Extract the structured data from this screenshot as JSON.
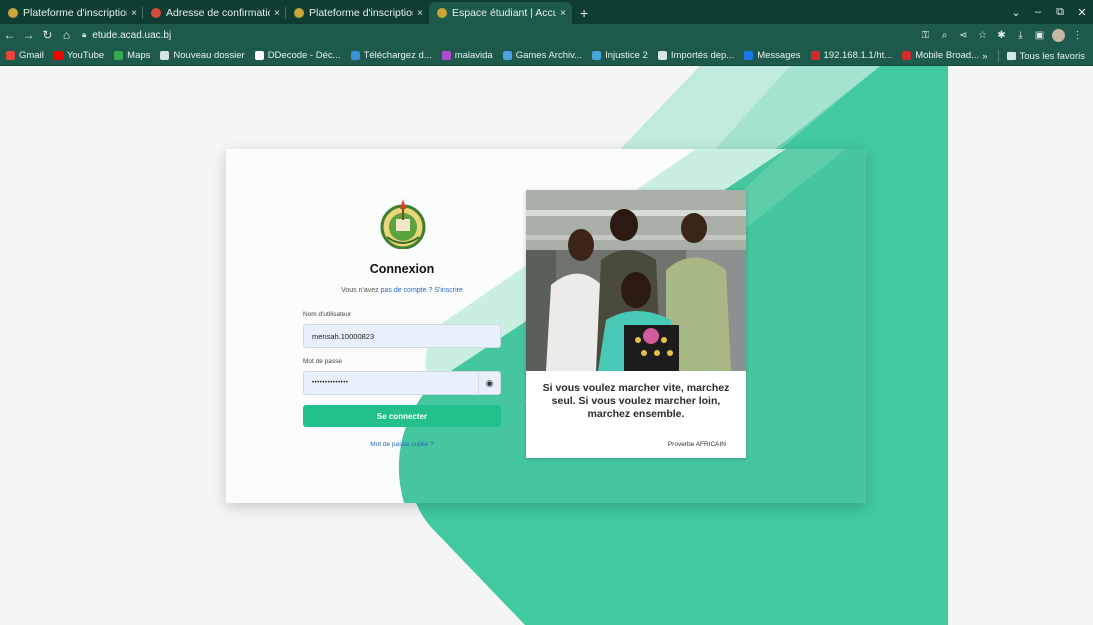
{
  "browser": {
    "tabs": [
      {
        "title": "Plateforme d'inscription",
        "favicon_color": "#c9a53a",
        "active": false
      },
      {
        "title": "Adresse de confirmation",
        "favicon_color": "#d84b3a",
        "active": false
      },
      {
        "title": "Plateforme d'inscription",
        "favicon_color": "#c9a53a",
        "active": false
      },
      {
        "title": "Espace étudiant | Accueil",
        "favicon_color": "#c9a53a",
        "active": true
      }
    ],
    "close_glyph": "×",
    "new_tab_glyph": "+",
    "window_controls": [
      "⌄",
      "–",
      "⧉",
      "✕"
    ],
    "url": "etude.acad.uac.bj",
    "bookmarks": [
      {
        "label": "Gmail",
        "icon": "gmail-icon",
        "color": "#e8453c"
      },
      {
        "label": "YouTube",
        "icon": "youtube-icon",
        "color": "#ff0000"
      },
      {
        "label": "Maps",
        "icon": "maps-icon",
        "color": "#34a853"
      },
      {
        "label": "Nouveau dossier",
        "icon": "folder-icon",
        "color": "#d7e4df"
      },
      {
        "label": "DDecode - Déc...",
        "icon": "site-icon",
        "color": "#ffffff"
      },
      {
        "label": "Téléchargez d...",
        "icon": "site-icon",
        "color": "#3d8fd6"
      },
      {
        "label": "malavida",
        "icon": "site-icon",
        "color": "#b04ad1"
      },
      {
        "label": "Games Archiv...",
        "icon": "site-icon",
        "color": "#4aa3e0"
      },
      {
        "label": "Injustice 2",
        "icon": "site-icon",
        "color": "#4aa3e0"
      },
      {
        "label": "Importés dep...",
        "icon": "folder-icon",
        "color": "#d7e4df"
      },
      {
        "label": "Messages",
        "icon": "facebook-icon",
        "color": "#1877f2"
      },
      {
        "label": "192.168.1.1/ht...",
        "icon": "router-icon",
        "color": "#d22b2b"
      },
      {
        "label": "Mobile Broad...",
        "icon": "router-icon",
        "color": "#d22b2b"
      }
    ],
    "bookmarks_overflow": "»",
    "all_bookmarks": "Tous les favoris"
  },
  "login": {
    "heading": "Connexion",
    "no_account_text": "Vous n'avez",
    "no_account_link": "pas de compte ?",
    "signup_link": "S'inscrire",
    "username_label": "Nom d'utilisateur",
    "username_value": "mensah.10000823",
    "password_label": "Mot de passe",
    "password_value": "••••••••••••••",
    "submit_label": "Se connecter",
    "forgot_label": "Mot de passe oublié ?"
  },
  "quote": {
    "text": "Si vous voulez marcher vite, marchez seul. Si vous voulez marcher loin, marchez ensemble.",
    "author": "Proverbe AFRICAIN"
  },
  "colors": {
    "accent": "#22c08c",
    "chrome_dark": "#0f3d33",
    "chrome": "#1e5a4b",
    "link": "#2a68c9"
  }
}
